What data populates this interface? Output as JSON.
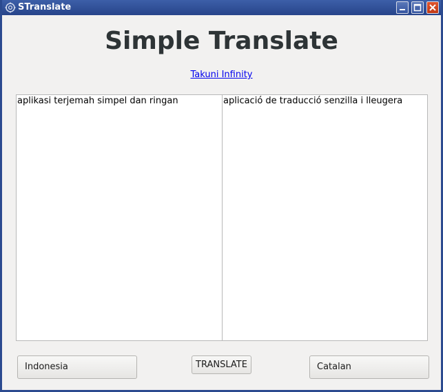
{
  "window": {
    "title": "STranslate",
    "icon": "gear-icon",
    "controls": [
      "minimize-icon",
      "maximize-icon",
      "close-icon"
    ],
    "colors": {
      "titlebar": "#2b4a8f",
      "close": "#d24a22"
    }
  },
  "main": {
    "heading": "Simple Translate",
    "link_text": "Takuni Infinity",
    "source_text": "aplikasi terjemah simpel dan ringan",
    "target_text": "aplicació de traducció senzilla i lleugera"
  },
  "footer": {
    "source_language": "Indonesia",
    "translate_label": "TRANSLATE",
    "target_language": "Catalan"
  }
}
